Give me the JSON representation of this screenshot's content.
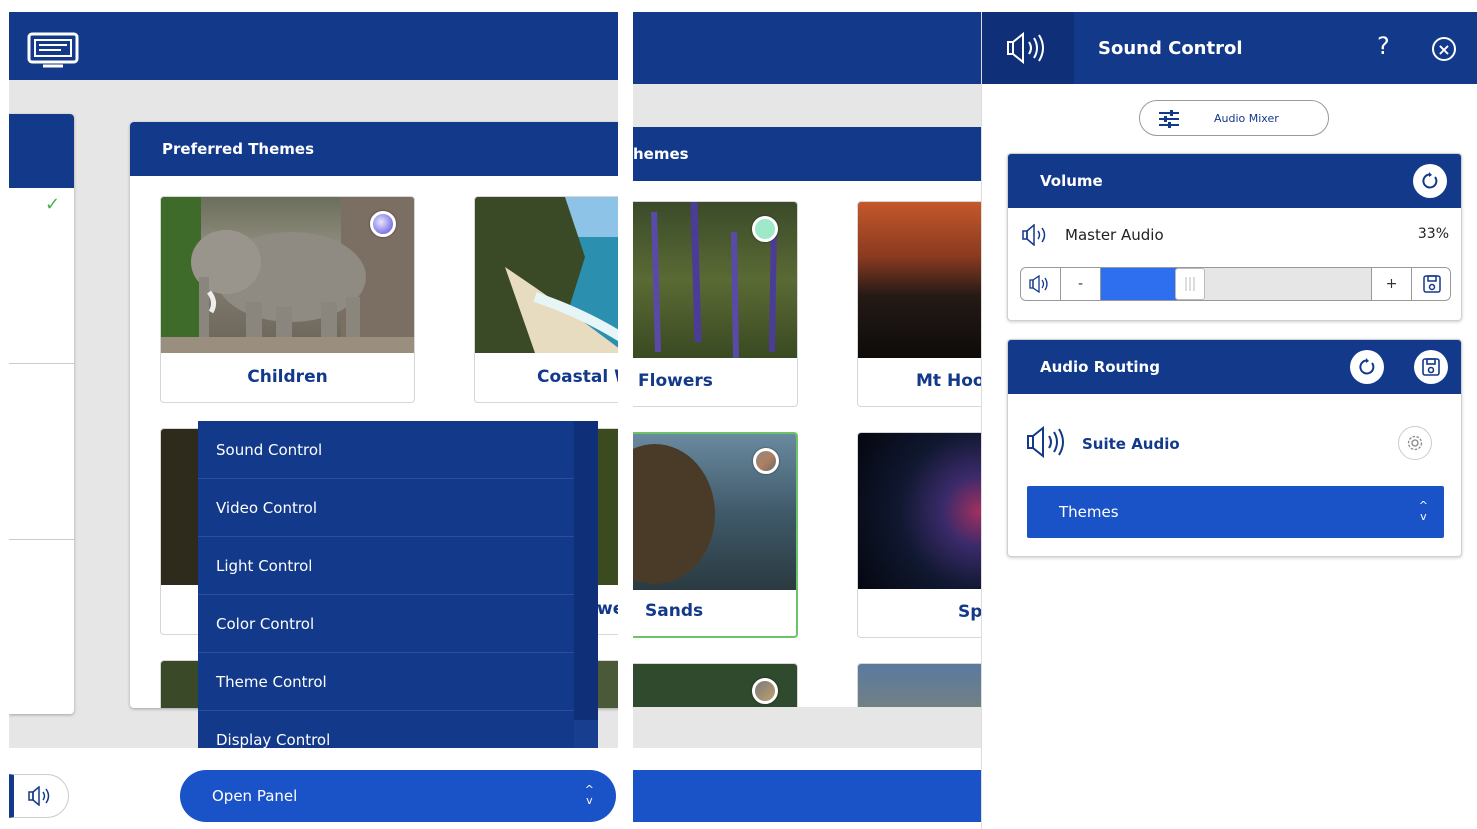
{
  "left_panel": {
    "header": {
      "icon": "monitor-icon"
    },
    "themes_title": "Preferred Themes",
    "themes": [
      {
        "label": "Children",
        "dot_color": "#8e86e8"
      },
      {
        "label": "Coastal W",
        "dot_color": null
      }
    ],
    "partial_label": "we",
    "menu": {
      "items": [
        "Sound Control",
        "Video Control",
        "Light Control",
        "Color Control",
        "Theme Control",
        "Display Control"
      ]
    },
    "open_panel_label": "Open Panel",
    "sidebar_check": "✓"
  },
  "right_bg": {
    "themes_title": "hemes",
    "themes": [
      {
        "label": "Flowers",
        "dot_color": "#9fe8c8"
      },
      {
        "label": "Mt Hoo"
      },
      {
        "label": "Sands",
        "selected": true
      },
      {
        "label": "Sp"
      }
    ]
  },
  "sound_control": {
    "title": "Sound Control",
    "help": "?",
    "close": "×",
    "audio_mixer_label": "Audio Mixer",
    "volume": {
      "title": "Volume",
      "channel_label": "Master Audio",
      "percent_label": "33%",
      "level": 0.33,
      "minus": "-",
      "plus": "+"
    },
    "routing": {
      "title": "Audio Routing",
      "source_label": "Suite Audio",
      "select_value": "Themes"
    }
  },
  "colors": {
    "brand_blue": "#12398a",
    "accent_blue": "#1a52c8",
    "slider_fill": "#2e6ff0",
    "check_green": "#4caf50",
    "selected_border": "#6cc36a"
  }
}
